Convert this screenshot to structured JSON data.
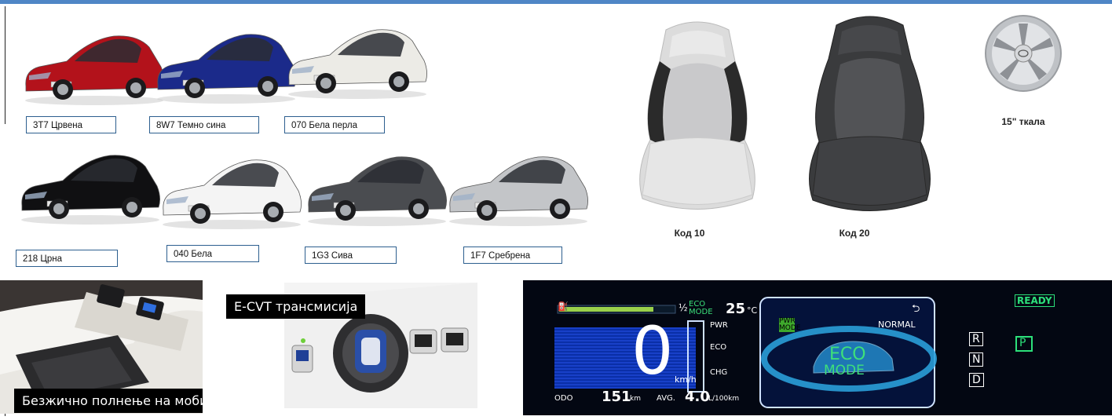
{
  "colors": [
    {
      "code_label": "3T7 Црвена",
      "hex": "#b3121b"
    },
    {
      "code_label": "8W7 Темно сина",
      "hex": "#1b2a8a"
    },
    {
      "code_label": "070 Бела перла",
      "hex": "#ecebe6"
    },
    {
      "code_label": "218 Црна",
      "hex": "#101012"
    },
    {
      "code_label": "040 Бела",
      "hex": "#f4f4f4"
    },
    {
      "code_label": "1G3 Сива",
      "hex": "#4a4c50"
    },
    {
      "code_label": "1F7 Сребрена",
      "hex": "#c3c5c8"
    }
  ],
  "seats": [
    {
      "label": "Код 10"
    },
    {
      "label": "Код 20"
    }
  ],
  "wheels": {
    "label": "15\" ткала"
  },
  "features": {
    "wireless_charging": "Безжично полнење на мобилен телефон",
    "ecvt": "E-CVT трансмисија"
  },
  "dashboard": {
    "fuel_fraction": "½",
    "eco_mode_small": "ECO MODE",
    "temperature": "25",
    "temperature_unit": "°C",
    "speed": "0",
    "speed_unit": "km/h",
    "hybrid_levels": [
      "PWR",
      "ECO",
      "CHG"
    ],
    "pwr_mode": "PWR MODE",
    "normal": "NORMAL",
    "eco_big_1": "ECO",
    "eco_big_2": "MODE",
    "ready": "READY",
    "gears": [
      "R",
      "N",
      "D"
    ],
    "park": "P",
    "odo_label": "ODO",
    "odo_value": "151",
    "odo_unit": "km",
    "avg_label": "AVG.",
    "avg_value": "4.0",
    "avg_unit": "L/100km"
  }
}
